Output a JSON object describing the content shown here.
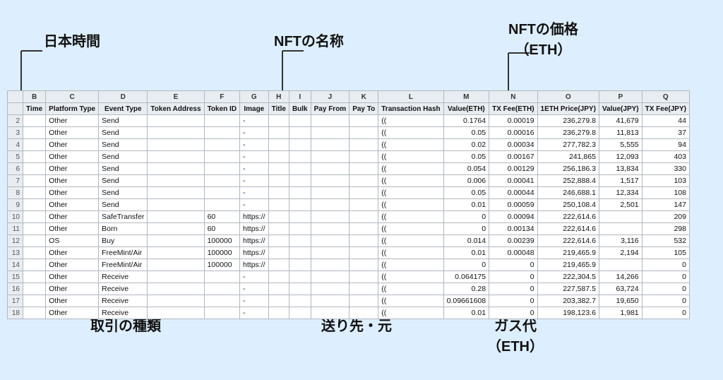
{
  "annotations": {
    "nihon_jikan": "日本時間",
    "nft_meisho": "NFTの名称",
    "nft_kakaku": "NFTの価格\n（ETH）",
    "torihiki_shurui": "取引の種類",
    "okuri_saki": "送り先・元",
    "gas_dai": "ガス代\n（ETH）"
  },
  "columns": {
    "headers": [
      "B",
      "C",
      "D",
      "E",
      "F",
      "G",
      "H",
      "I",
      "J",
      "K",
      "L",
      "M",
      "N",
      "O",
      "P",
      "Q"
    ],
    "labels": [
      "Time",
      "Platform Type",
      "Event Type",
      "Token Address",
      "Token ID",
      "Image",
      "Title",
      "Bulk",
      "Pay From",
      "Pay To",
      "Transaction Hash",
      "Value(ETH)",
      "TX Fee(ETH)",
      "1ETH Price(JPY)",
      "Value(JPY)",
      "TX Fee(JPY)"
    ]
  },
  "rows": [
    [
      "",
      "Other",
      "Send",
      "",
      "",
      "-",
      "",
      "",
      "",
      "",
      "(( ",
      "0.1764",
      "0.00019",
      "236,279.8",
      "41,679",
      "44"
    ],
    [
      "",
      "Other",
      "Send",
      "",
      "",
      "-",
      "",
      "",
      "",
      "",
      "(( ",
      "0.05",
      "0.00016",
      "236,279.8",
      "11,813",
      "37"
    ],
    [
      "",
      "Other",
      "Send",
      "",
      "",
      "-",
      "",
      "",
      "",
      "",
      "(( ",
      "0.02",
      "0.00034",
      "277,782.3",
      "5,555",
      "94"
    ],
    [
      "",
      "Other",
      "Send",
      "",
      "",
      "-",
      "",
      "",
      "",
      "",
      "(( ",
      "0.05",
      "0.00167",
      "241,865",
      "12,093",
      "403"
    ],
    [
      "",
      "Other",
      "Send",
      "",
      "",
      "-",
      "",
      "",
      "",
      "",
      "(( ",
      "0.054",
      "0.00129",
      "256,186.3",
      "13,834",
      "330"
    ],
    [
      "",
      "Other",
      "Send",
      "",
      "",
      "-",
      "",
      "",
      "",
      "",
      "(( ",
      "0.006",
      "0.00041",
      "252,888.4",
      "1,517",
      "103"
    ],
    [
      "",
      "Other",
      "Send",
      "",
      "",
      "-",
      "",
      "",
      "",
      "",
      "(( ",
      "0.05",
      "0.00044",
      "246,688.1",
      "12,334",
      "108"
    ],
    [
      "",
      "Other",
      "Send",
      "",
      "",
      "-",
      "",
      "",
      "",
      "",
      "(( ",
      "0.01",
      "0.00059",
      "250,108.4",
      "2,501",
      "147"
    ],
    [
      "",
      "Other",
      "SafeTransfer",
      "",
      "60",
      "https://",
      "",
      "",
      "",
      "",
      "(( ",
      "0",
      "0.00094",
      "222,614.6",
      "",
      "209"
    ],
    [
      "",
      "Other",
      "Born",
      "",
      "60",
      "https://",
      "",
      "",
      "",
      "",
      "(( ",
      "0",
      "0.00134",
      "222,614.6",
      "",
      "298"
    ],
    [
      "",
      "OS",
      "Buy",
      "",
      "100000",
      "https://",
      "",
      "",
      "",
      "",
      "(( ",
      "0.014",
      "0.00239",
      "222,614.6",
      "3,116",
      "532"
    ],
    [
      "",
      "Other",
      "FreeMint/Air",
      "",
      "100000",
      "https://",
      "",
      "",
      "",
      "",
      "(( ",
      "0.01",
      "0.00048",
      "219,465.9",
      "2,194",
      "105"
    ],
    [
      "",
      "Other",
      "FreeMint/Air",
      "",
      "100000",
      "https://",
      "",
      "",
      "",
      "",
      "(( ",
      "0",
      "0",
      "219,465.9",
      "",
      "0"
    ],
    [
      "",
      "Other",
      "Receive",
      "",
      "",
      "-",
      "",
      "",
      "",
      "",
      "(( ",
      "0.064175",
      "0",
      "222,304.5",
      "14,266",
      "0"
    ],
    [
      "",
      "Other",
      "Receive",
      "",
      "",
      "-",
      "",
      "",
      "",
      "",
      "(( ",
      "0.28",
      "0",
      "227,587.5",
      "63,724",
      "0"
    ],
    [
      "",
      "Other",
      "Receive",
      "",
      "",
      "-",
      "",
      "",
      "",
      "",
      "(( ",
      "0.09661608",
      "0",
      "203,382.7",
      "19,650",
      "0"
    ],
    [
      "",
      "Other",
      "Receive",
      "",
      "",
      "-",
      "",
      "",
      "",
      "",
      "(( ",
      "0.01",
      "0",
      "198,123.6",
      "1,981",
      "0"
    ]
  ]
}
